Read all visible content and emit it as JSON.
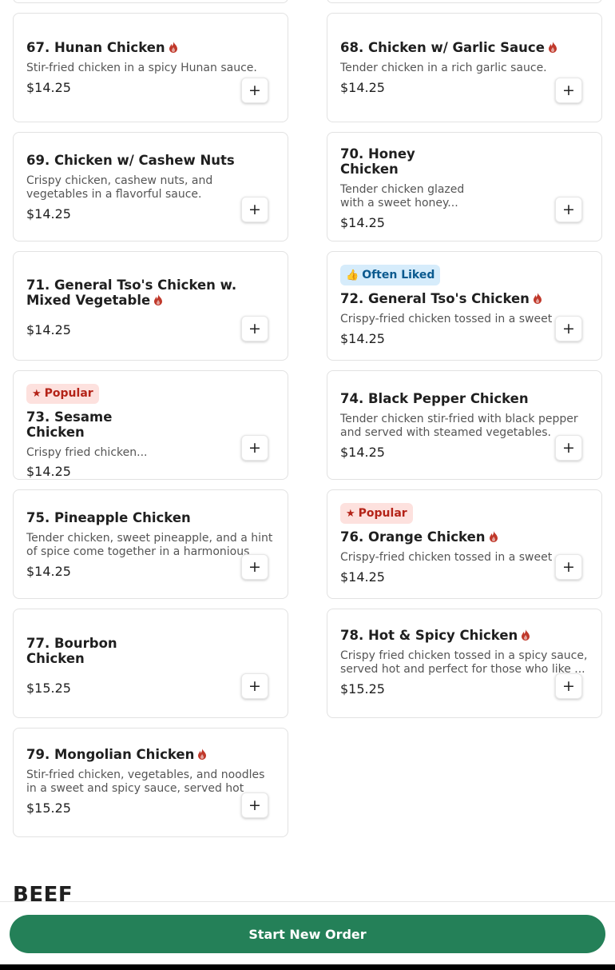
{
  "colors": {
    "brand_green": "#248058",
    "spicy_red": "#c0392b",
    "popular_bg": "#fde1de",
    "popular_text": "#b42318",
    "liked_bg": "#d6ecfb",
    "liked_text": "#0b5a8f"
  },
  "items": [
    {
      "title": "67. Hunan Chicken",
      "desc": "Stir-fried chicken in a spicy Hunan sauce.",
      "price": "$14.25",
      "spicy": true
    },
    {
      "title": "68. Chicken w/ Garlic Sauce",
      "desc": "Tender chicken in a rich garlic sauce.",
      "price": "$14.25",
      "spicy": true
    },
    {
      "title": "69. Chicken w/ Cashew Nuts",
      "desc": "Crispy chicken, cashew nuts, and vegetables in a flavorful sauce.",
      "price": "$14.25",
      "spicy": false
    },
    {
      "title": "70. Honey Chicken",
      "desc": "Tender chicken glazed with a sweet honey...",
      "price": "$14.25",
      "spicy": false
    },
    {
      "title": "71. General Tso's Chicken w. Mixed Vegetable",
      "desc": "",
      "price": "$14.25",
      "spicy": true
    },
    {
      "badge": "Often Liked",
      "badge_icon": "thumbs-up-icon",
      "title": "72. General Tso's Chicken",
      "desc": "Crispy-fried chicken tossed in a sweet ...",
      "price": "$14.25",
      "spicy": true
    },
    {
      "badge": "Popular",
      "badge_icon": "star-icon",
      "title": "73. Sesame Chicken",
      "desc": "Crispy fried chicken...",
      "price": "$14.25",
      "spicy": false
    },
    {
      "title": "74. Black Pepper Chicken",
      "desc": "Tender chicken stir-fried with black pepper and served with steamed vegetables.",
      "price": "$14.25",
      "spicy": false
    },
    {
      "title": "75. Pineapple Chicken",
      "desc": "Tender chicken, sweet pineapple, and a hint of spice come together in a harmonious",
      "price": "$14.25",
      "spicy": false
    },
    {
      "badge": "Popular",
      "badge_icon": "star-icon",
      "title": "76. Orange Chicken",
      "desc": "Crispy-fried chicken tossed in a sweet ...",
      "price": "$14.25",
      "spicy": true
    },
    {
      "title": "77. Bourbon Chicken",
      "desc": "",
      "price": "$15.25",
      "spicy": false
    },
    {
      "title": "78. Hot & Spicy Chicken",
      "desc": "Crispy fried chicken tossed in a spicy sauce, served hot and perfect for those who like ...",
      "price": "$15.25",
      "spicy": true
    },
    {
      "title": "79. Mongolian Chicken",
      "desc": "Stir-fried chicken, vegetables, and noodles in a sweet and spicy sauce, served hot",
      "price": "$15.25",
      "spicy": true
    }
  ],
  "add_label": "+",
  "next_section": "BEEF",
  "cta": {
    "label": "Start New Order"
  }
}
